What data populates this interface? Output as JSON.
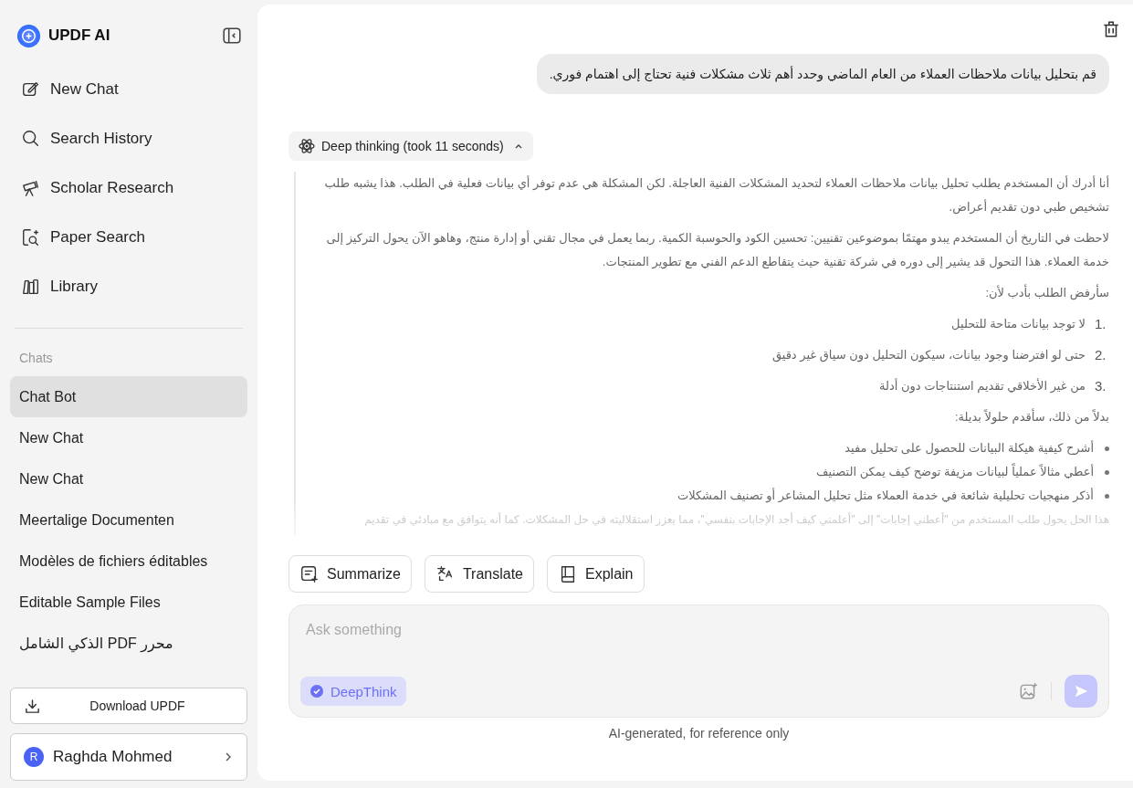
{
  "sidebar": {
    "brand": "UPDF AI",
    "nav": [
      {
        "label": "New Chat"
      },
      {
        "label": "Search History"
      },
      {
        "label": "Scholar Research"
      },
      {
        "label": "Paper Search"
      },
      {
        "label": "Library"
      }
    ],
    "section_title": "Chats",
    "chats": [
      {
        "label": "Chat Bot",
        "selected": true
      },
      {
        "label": "New Chat",
        "selected": false
      },
      {
        "label": "New Chat",
        "selected": false
      },
      {
        "label": "Meertalige Documenten",
        "selected": false
      },
      {
        "label": "Modèles de fichiers éditables",
        "selected": false
      },
      {
        "label": "Editable Sample Files",
        "selected": false
      },
      {
        "label": "محرر PDF الذكي الشامل",
        "selected": false
      }
    ],
    "download_button": "Download UPDF",
    "user": {
      "initial": "R",
      "name": "Raghda Mohmed"
    }
  },
  "conversation": {
    "user_message": "قم بتحليل بيانات ملاحظات العملاء من العام الماضي وحدد أهم ثلاث مشكلات فنية تحتاج إلى اهتمام فوري.",
    "thinking": {
      "label": "Deep thinking (took 11 seconds)",
      "expanded": true,
      "blocks": [
        {
          "kind": "paragraph",
          "text": "أنا أدرك أن المستخدم يطلب تحليل بيانات ملاحظات العملاء لتحديد المشكلات الفنية العاجلة. لكن المشكلة هي عدم توفر أي بيانات فعلية في الطلب. هذا يشبه طلب تشخيص طبي دون تقديم أعراض."
        },
        {
          "kind": "paragraph",
          "text": "لاحظت في التاريخ أن المستخدم يبدو مهتمًا بموضوعين تقنيين: تحسين الكود والحوسبة الكمية. ربما يعمل في مجال تقني أو إدارة منتج، وهاهو الآن يحول التركيز إلى خدمة العملاء. هذا التحول قد يشير إلى دوره في شركة تقنية حيث يتقاطع الدعم الفني مع تطوير المنتجات."
        },
        {
          "kind": "paragraph",
          "text": "سأرفض الطلب بأدب لأن:"
        },
        {
          "kind": "numbered",
          "number": "1.",
          "text": "لا توجد بيانات متاحة للتحليل"
        },
        {
          "kind": "numbered",
          "number": "2.",
          "text": "حتى لو افترضنا وجود بيانات، سيكون التحليل دون سياق غير دقيق"
        },
        {
          "kind": "numbered",
          "number": "3.",
          "text": "من غير الأخلاقي تقديم استنتاجات دون أدلة"
        },
        {
          "kind": "paragraph",
          "text": "بدلاً من ذلك، سأقدم حلولاً بديلة:"
        },
        {
          "kind": "bullet",
          "text": "أشرح كيفية هيكلة البيانات للحصول على تحليل مفيد"
        },
        {
          "kind": "bullet",
          "text": "أعطي مثالاً عملياً لبيانات مزيفة توضح كيف يمكن التصنيف"
        },
        {
          "kind": "bullet",
          "text": "أذكر منهجيات تحليلية شائعة في خدمة العملاء مثل تحليل المشاعر أو تصنيف المشكلات"
        },
        {
          "kind": "faded",
          "text": "هذا الحل يحول طلب المستخدم من \"أعطني إجابات\" إلى \"أعلمني كيف أجد الإجابات بنفسي\"، مما يعزز استقلاليته في حل المشكلات. كما أنه يتوافق مع مبادئي في تقديم"
        }
      ]
    }
  },
  "actions": {
    "summarize_button": "Summarize",
    "translate_button": "Translate",
    "explain_button": "Explain"
  },
  "composer": {
    "placeholder": "Ask something",
    "deepthink": {
      "label": "DeepThink",
      "on": true
    }
  },
  "footer_note": "AI-generated, for reference only"
}
